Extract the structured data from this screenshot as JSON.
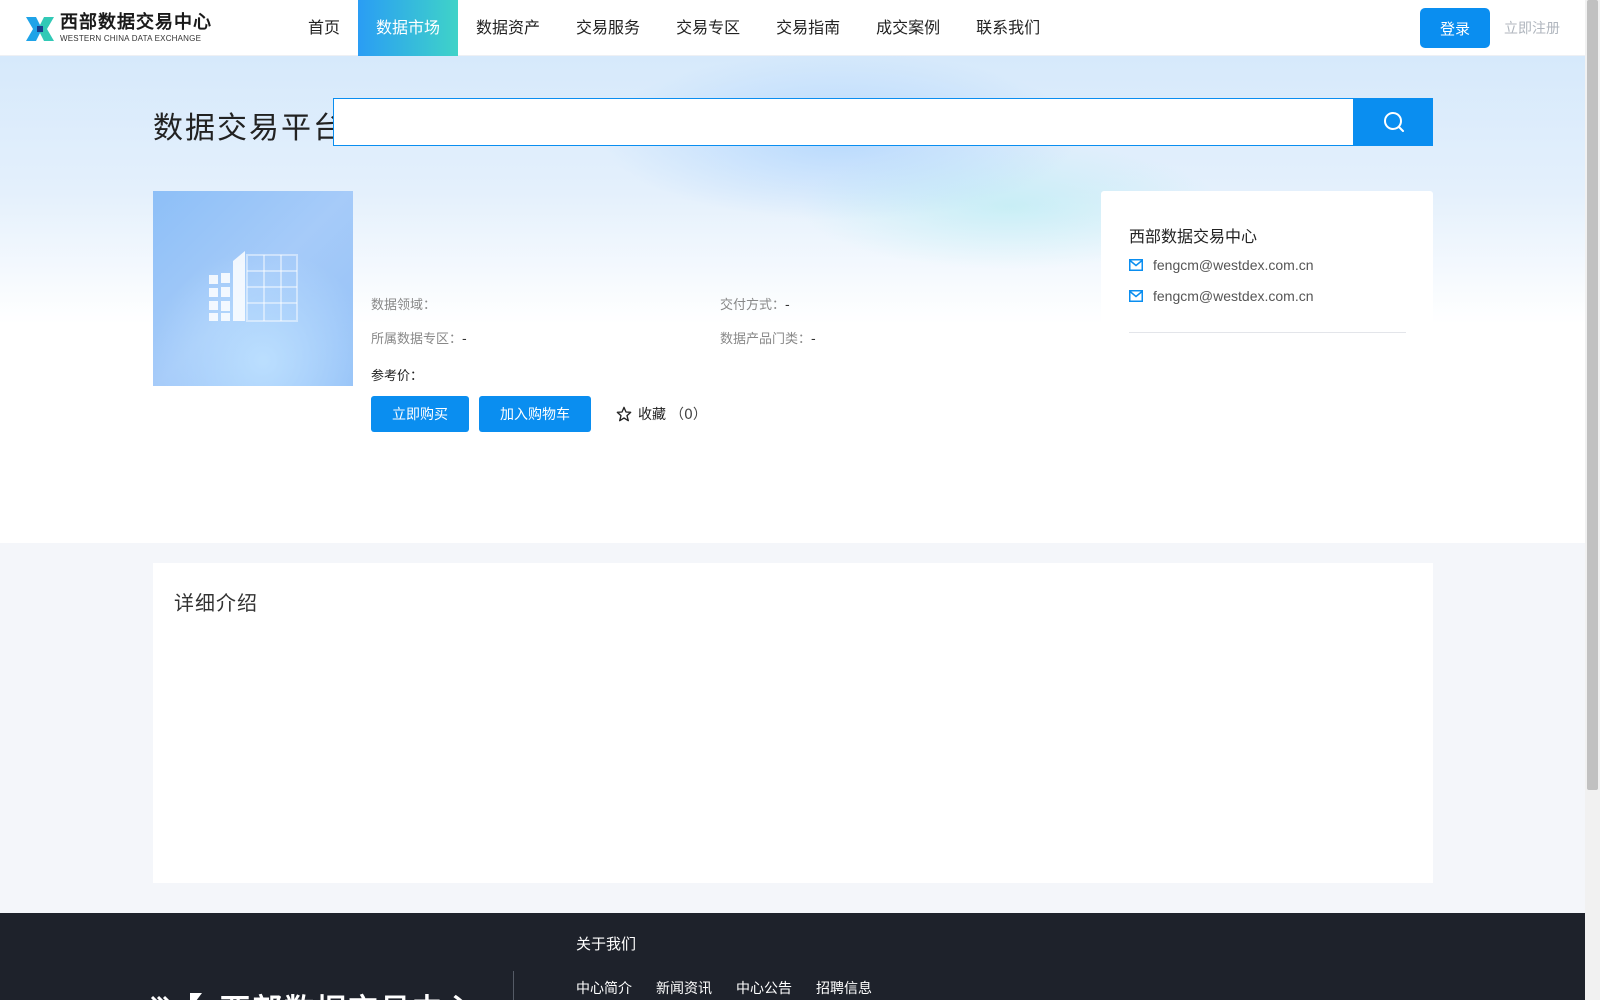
{
  "header": {
    "logo_cn": "西部数据交易中心",
    "logo_en": "WESTERN CHINA DATA EXCHANGE",
    "nav": [
      "首页",
      "数据市场",
      "数据资产",
      "交易服务",
      "交易专区",
      "交易指南",
      "成交案例",
      "联系我们"
    ],
    "active_nav": "数据市场",
    "login": "登录",
    "register": "立即注册"
  },
  "search": {
    "title": "数据交易平台",
    "value": "",
    "icon": "search-icon"
  },
  "product": {
    "image_icon": "building-icon",
    "data_field_label": "数据领域：",
    "data_field_value": "",
    "delivery_label": "交付方式：",
    "delivery_value": "-",
    "zone_label": "所属数据专区：",
    "zone_value": "-",
    "category_label": "数据产品门类：",
    "category_value": "-",
    "ref_price_label": "参考价：",
    "buy_now": "立即购买",
    "add_cart": "加入购物车",
    "favorite": "收藏",
    "favorite_count": "（0）"
  },
  "vendor": {
    "name": "西部数据交易中心",
    "emails": [
      "fengcm@westdex.com.cn",
      "fengcm@westdex.com.cn"
    ]
  },
  "detail": {
    "title": "详细介绍"
  },
  "footer": {
    "brand": "西部数据交易中心",
    "about": "关于我们",
    "links": [
      "中心简介",
      "新闻资讯",
      "中心公告",
      "招聘信息"
    ]
  },
  "colors": {
    "primary": "#0a8ef0",
    "nav_active_start": "#2a9df4",
    "nav_active_end": "#3fd3c8",
    "footer_bg": "#1e222b"
  }
}
